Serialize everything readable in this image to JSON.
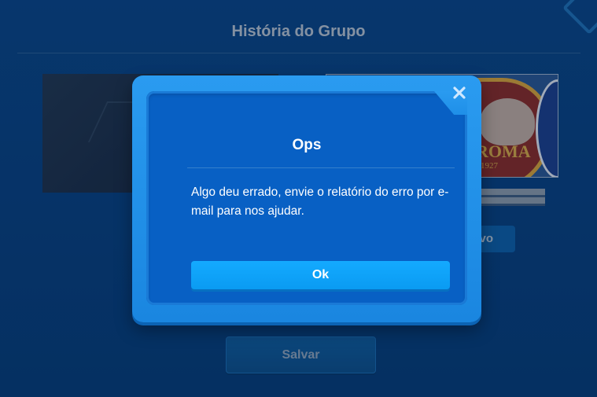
{
  "background": {
    "page_title": "História do Grupo",
    "logo_text": "ROMA",
    "logo_year": "1927",
    "partial_button_label": "vo",
    "save_button_label": "Salvar"
  },
  "dialog": {
    "title": "Ops",
    "message": "Algo deu errado, envie o relatório do erro por e-mail para nos ajudar.",
    "ok_label": "Ok",
    "close_icon": "close-icon"
  },
  "colors": {
    "page_bg": "#0a4585",
    "dialog_frame": "#2a9bf0",
    "dialog_inner": "#0860c4",
    "ok_button": "#14aaff",
    "text": "#ffffff"
  }
}
